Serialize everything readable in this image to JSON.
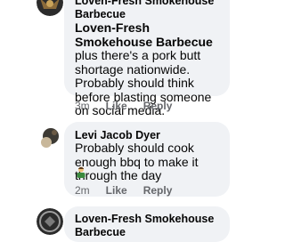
{
  "comments": [
    {
      "author_line1": "Loven-Fresh Smokehouse",
      "author_line2": "Barbecue",
      "mention": "Loven-Fresh Smokehouse Barbecue",
      "text_rest": " plus there's a pork butt shortage nationwide. Probably should think before blasting someone on social media.",
      "time": "3m",
      "like": "Like",
      "reply": "Reply"
    },
    {
      "author": "Levi Jacob Dyer",
      "text": "Probably should cook enough bbq to make it through the day",
      "emoji_icon": "person-emoji-icon",
      "time": "2m",
      "like": "Like",
      "reply": "Reply"
    },
    {
      "author_line1": "Loven-Fresh Smokehouse",
      "author_line2": "Barbecue"
    }
  ],
  "colors": {
    "bubble": "#f0f2f5",
    "text": "#050505",
    "meta": "#65676b"
  }
}
